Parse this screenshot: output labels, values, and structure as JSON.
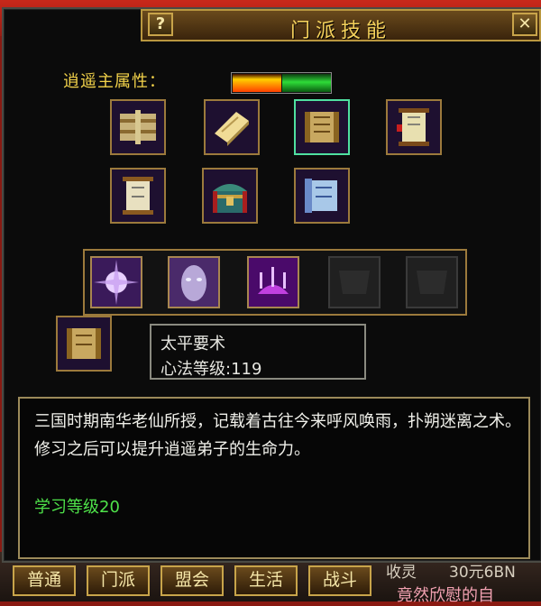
{
  "window": {
    "title": "门派技能",
    "help_label": "?",
    "close_label": "✕"
  },
  "attribute": {
    "label": "逍遥主属性："
  },
  "items_row1": [
    "scroll-bundle-icon",
    "book-icon",
    "scroll-open-icon",
    "scroll-icon"
  ],
  "items_row2": [
    "scroll-icon",
    "treasure-chest-icon",
    "scroll-blue-icon"
  ],
  "skills": [
    "burst-skill-icon",
    "ghost-face-skill-icon",
    "chandelier-skill-icon",
    "empty-slot",
    "empty-slot"
  ],
  "selected_skill": {
    "name": "太平要术",
    "level_text": "心法等级:119"
  },
  "description": {
    "text": "三国时期南华老仙所授，记载着古往今来呼风唤雨，扑朔迷离之术。修习之后可以提升逍遥弟子的生命力。",
    "learn_level": "学习等级20"
  },
  "tabs": [
    "普通",
    "门派",
    "盟会",
    "生活",
    "战斗"
  ],
  "background": {
    "bottom_right_1": "收灵",
    "bottom_right_2": "30元6BN",
    "bottom_chat": "竟然欣慰的自"
  },
  "colors": {
    "title": "#f5d25c",
    "label_gold": "#f2d24a",
    "learn_green": "#4fe34a",
    "frame_gold": "#9c7a3c",
    "selected_teal": "#4fe0a0"
  }
}
